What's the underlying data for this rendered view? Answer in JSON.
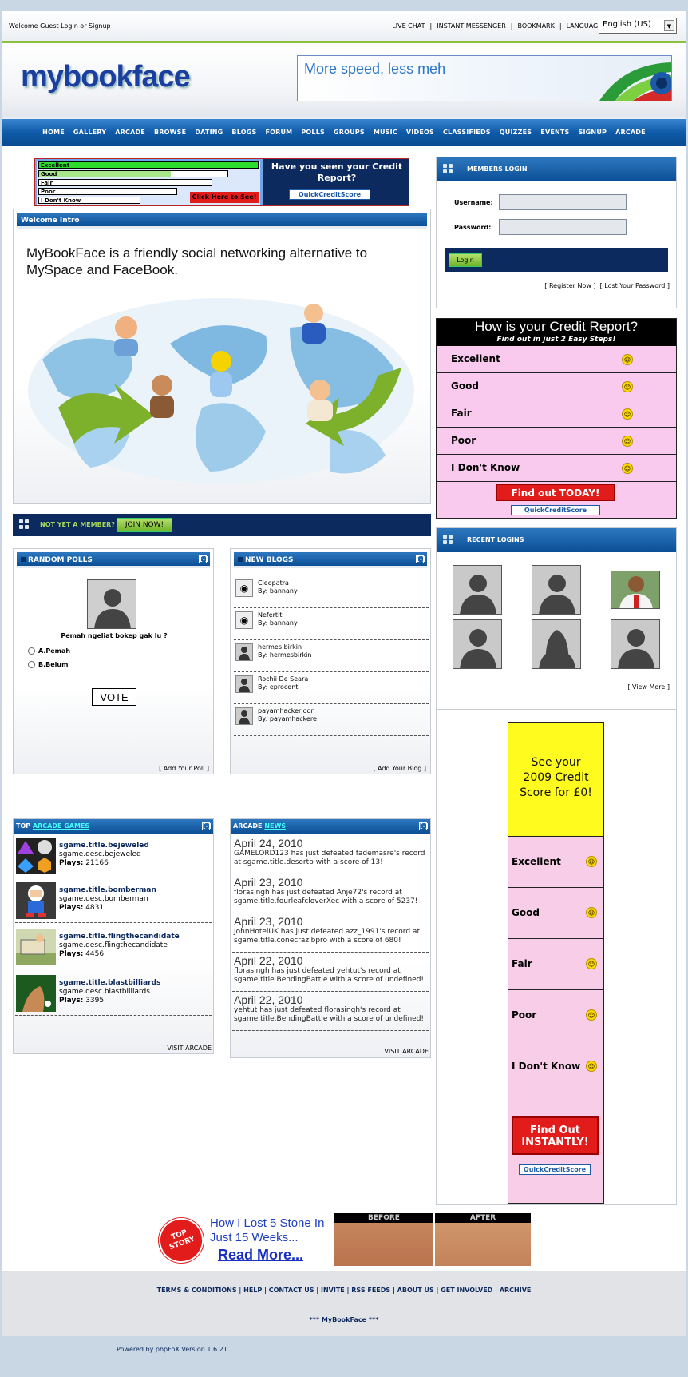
{
  "top": {
    "welcome": "Welcome Guest Login or Signup",
    "links": [
      "LIVE CHAT",
      "|",
      "INSTANT MESSENGER",
      "|",
      "BOOKMARK",
      "|",
      "LANGUAGE:"
    ],
    "language": "English (US)"
  },
  "header": {
    "logo": "mybookface",
    "banner_text": "More speed, less meh"
  },
  "nav": [
    "HOME",
    "GALLERY",
    "ARCADE",
    "BROWSE",
    "DATING",
    "BLOGS",
    "FORUM",
    "POLLS",
    "GROUPS",
    "MUSIC",
    "VIDEOS",
    "CLASSIFIEDS",
    "QUIZZES",
    "EVENTS",
    "SIGNUP",
    "ARCADE"
  ],
  "ad_top": {
    "rows": [
      "Excellent",
      "Good",
      "Fair",
      "Poor",
      "I Don't Know"
    ],
    "cta": "Click Here to See!",
    "headline": "Have you seen your Credit Report?",
    "brand": "QuickCreditScore"
  },
  "intro": {
    "title": "Welcome Intro",
    "text": "MyBookFace is a friendly social networking alternative to MySpace and FaceBook."
  },
  "join": {
    "label": "NOT YET A MEMBER?",
    "button": "JOIN NOW!"
  },
  "polls": {
    "title": "RANDOM POLLS",
    "toggle": "[-]",
    "question": "Pemah ngeliat bokep gak lu ?",
    "options": [
      "A.Pemah",
      "B.Belum"
    ],
    "vote": "VOTE",
    "footer": "[ Add Your Poll ]"
  },
  "blogs": {
    "title": "NEW BLOGS",
    "toggle": "[-]",
    "items": [
      {
        "title": "Cleopatra",
        "by": "By: bannany"
      },
      {
        "title": "Nefertiti",
        "by": "By: bannany"
      },
      {
        "title": "hermes birkin",
        "by": "By: hermesbirkin"
      },
      {
        "title": "Rochii De Seara",
        "by": "By: eprocent"
      },
      {
        "title": "payamhackerjoon",
        "by": "By: payamhackere"
      }
    ],
    "footer": "[ Add Your Blog ]"
  },
  "games": {
    "title_prefix": "TOP",
    "title_link": "ARCADE GAMES",
    "toggle": "[-]",
    "items": [
      {
        "title": "sgame.title.bejeweled",
        "desc": "sgame.desc.bejeweled",
        "plays_label": "Plays:",
        "plays": "21166"
      },
      {
        "title": "sgame.title.bomberman",
        "desc": "sgame.desc.bomberman",
        "plays_label": "Plays:",
        "plays": "4831"
      },
      {
        "title": "sgame.title.flingthecandidate",
        "desc": "sgame.desc.flingthecandidate",
        "plays_label": "Plays:",
        "plays": "4456"
      },
      {
        "title": "sgame.title.blastbilliards",
        "desc": "sgame.desc.blastbilliards",
        "plays_label": "Plays:",
        "plays": "3395"
      }
    ],
    "footer": "VISIT ARCADE"
  },
  "news": {
    "title_prefix": "ARCADE",
    "title_link": "NEWS",
    "toggle": "[-]",
    "items": [
      {
        "date": "April 24, 2010",
        "text": "GAMELORD123 has just defeated fademasre's record at sgame.title.desertb with a score of 13!"
      },
      {
        "date": "April 23, 2010",
        "text": "florasingh has just defeated Anje72's record at sgame.title.fourleafcloverXec with a score of 5237!"
      },
      {
        "date": "April 23, 2010",
        "text": "JohnHotelUK has just defeated azz_1991's record at sgame.title.conecrazibpro with a score of 680!"
      },
      {
        "date": "April 22, 2010",
        "text": "florasingh has just defeated yehtut's record at sgame.title.BendingBattle with a score of undefined!"
      },
      {
        "date": "April 22, 2010",
        "text": "yehtut has just defeated florasingh's record at sgame.title.BendingBattle with a score of undefined!"
      }
    ],
    "footer": "VISIT ARCADE"
  },
  "login": {
    "title": "MEMBERS LOGIN",
    "username_label": "Username:",
    "password_label": "Password:",
    "button": "Login",
    "links": "[ Register Now ]  [ Lost Your Password ]"
  },
  "credit_ad": {
    "headline": "How is your Credit Report?",
    "sub": "Find out in just 2 Easy Steps!",
    "rows": [
      "Excellent",
      "Good",
      "Fair",
      "Poor",
      "I Don't Know"
    ],
    "cta": "Find out TODAY!",
    "brand": "QuickCreditScore"
  },
  "recent": {
    "title": "RECENT LOGINS",
    "footer": "[ View More ]"
  },
  "credit_ad2": {
    "headline": "See your 2009 Credit Score for £0!",
    "rows": [
      "Excellent",
      "Good",
      "Fair",
      "Poor",
      "I Don't Know"
    ],
    "cta": "Find Out INSTANTLY!",
    "brand": "QuickCreditScore"
  },
  "story_ad": {
    "badge": "TOP STORY",
    "headline": "How I Lost 5 Stone In Just 15 Weeks...",
    "link": "Read More...",
    "before": "BEFORE",
    "after": "AFTER"
  },
  "footer": {
    "links": "TERMS & CONDITIONS | HELP | CONTACT US | INVITE | RSS FEEDS | ABOUT US | GET INVOLVED | ARCHIVE",
    "brand": "*** MyBookFace ***",
    "powered": "Powered by phpFoX Version 1.6.21"
  },
  "colors": {
    "nav_blue": "#0e5aa8",
    "accent_green": "#8dbf3e",
    "dark_navy": "#0d2a5e"
  }
}
